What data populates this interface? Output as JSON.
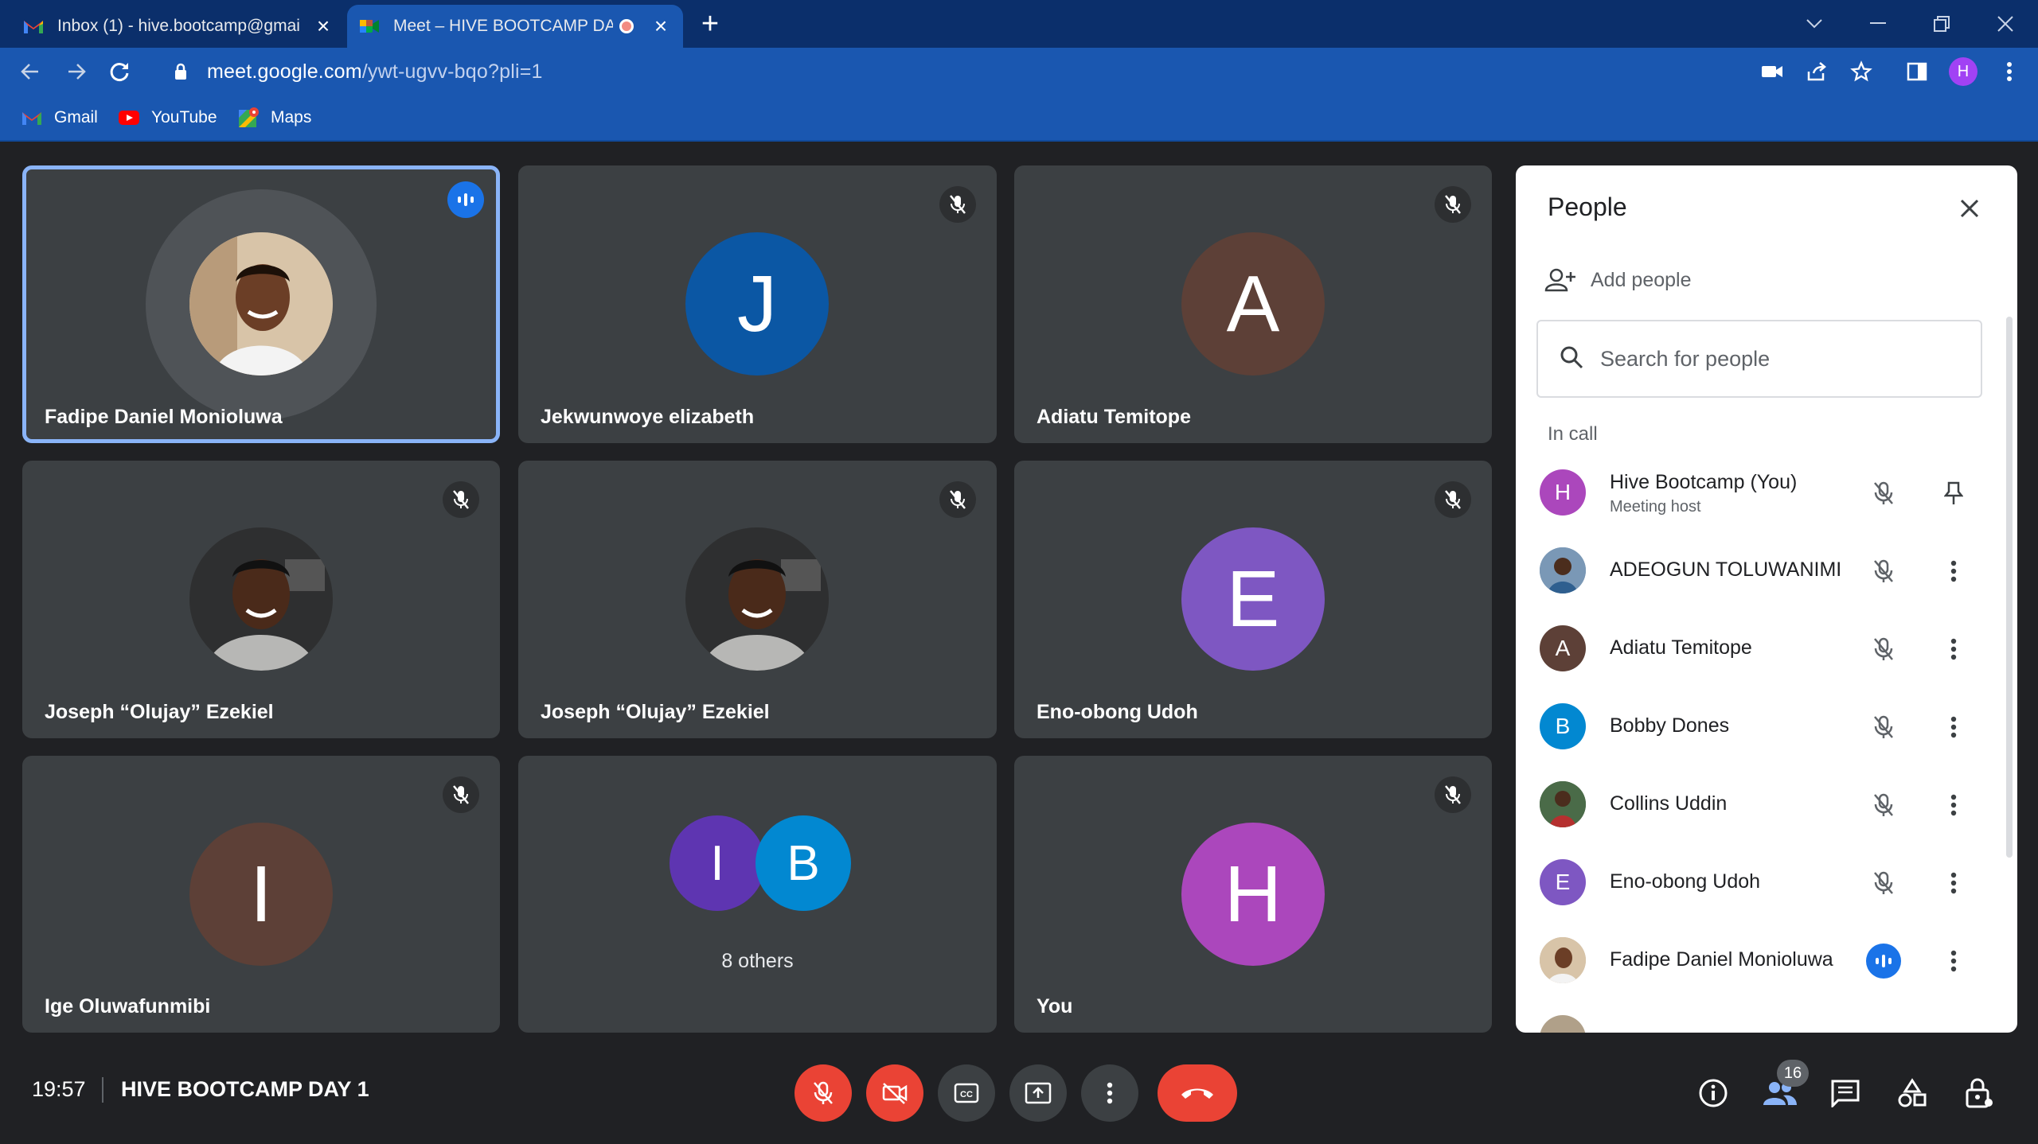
{
  "browser": {
    "tabs": [
      {
        "title": "Inbox (1) - hive.bootcamp@gmai",
        "icon": "gmail-icon",
        "active": false
      },
      {
        "title": "Meet – HIVE BOOTCAMP DA",
        "icon": "meet-icon",
        "active": true
      }
    ],
    "url_host": "meet.google.com",
    "url_path": "/ywt-ugvv-bqo?pli=1",
    "profile_initial": "H",
    "bookmarks": [
      {
        "label": "Gmail",
        "icon": "gmail-icon"
      },
      {
        "label": "YouTube",
        "icon": "youtube-icon"
      },
      {
        "label": "Maps",
        "icon": "maps-icon"
      }
    ]
  },
  "tiles": [
    {
      "name": "Fadipe Daniel Monioluwa",
      "speaking": true
    },
    {
      "name": "Jekwunwoye elizabeth",
      "initial": "J",
      "color": "#0b57a4",
      "muted": true
    },
    {
      "name": "Adiatu Temitope",
      "initial": "A",
      "color": "#5d4037",
      "muted": true
    },
    {
      "name": "Joseph “Olujay” Ezekiel",
      "muted": true
    },
    {
      "name": "Joseph “Olujay” Ezekiel",
      "muted": true
    },
    {
      "name": "Eno-obong Udoh",
      "initial": "E",
      "color": "#7e57c2",
      "muted": true
    },
    {
      "name": "Ige Oluwafunmibi",
      "initial": "I",
      "color": "#5d4037",
      "muted": true
    },
    {
      "others_label": "8 others",
      "initials": [
        "I",
        "B"
      ],
      "colors": [
        "#5e35b1",
        "#0288d1"
      ]
    },
    {
      "name": "You",
      "initial": "H",
      "color": "#ab47bc",
      "muted": true
    }
  ],
  "people_panel": {
    "title": "People",
    "add_people_label": "Add people",
    "search_placeholder": "Search for people",
    "section_label": "In call",
    "people": [
      {
        "name": "Hive Bootcamp (You)",
        "subtitle": "Meeting host",
        "initial": "H",
        "color": "#ab47bc"
      },
      {
        "name": "ADEOGUN TOLUWANIMI",
        "photo": true
      },
      {
        "name": "Adiatu Temitope",
        "initial": "A",
        "color": "#5d4037"
      },
      {
        "name": "Bobby Dones",
        "initial": "B",
        "color": "#0288d1"
      },
      {
        "name": "Collins Uddin",
        "photo": true
      },
      {
        "name": "Eno-obong Udoh",
        "initial": "E",
        "color": "#7e57c2"
      },
      {
        "name": "Fadipe Daniel Monioluwa",
        "photo": true,
        "speaking": true
      }
    ]
  },
  "bottom_bar": {
    "time": "19:57",
    "meeting_title": "HIVE BOOTCAMP DAY 1",
    "participant_count": "16"
  },
  "colors": {
    "accent_blue": "#1a73e8",
    "danger_red": "#ea4335",
    "tile_bg": "#3c4043",
    "stage_bg": "#202124"
  }
}
